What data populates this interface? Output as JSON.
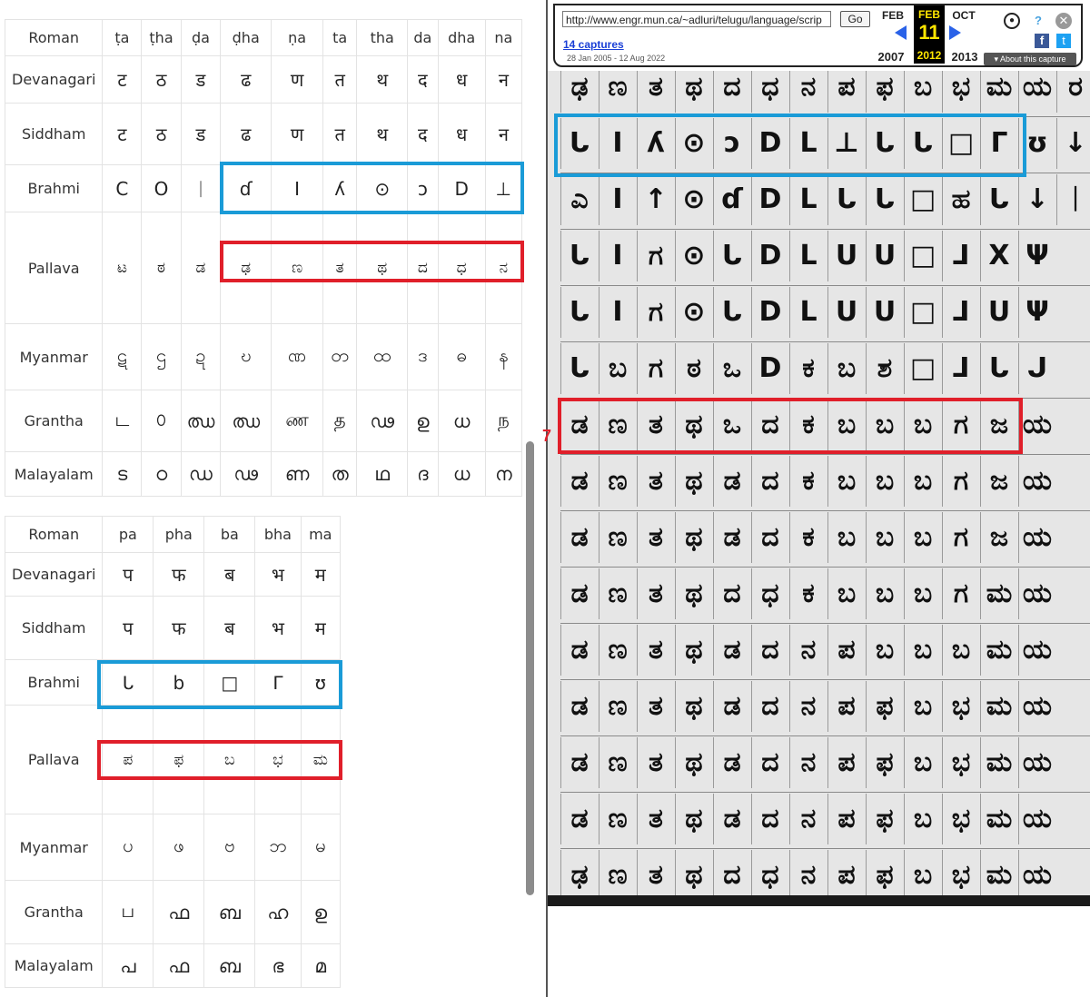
{
  "table1": {
    "header": "Roman",
    "columns": [
      "ṭa",
      "ṭha",
      "ḍa",
      "ḍha",
      "ṇa",
      "ta",
      "tha",
      "da",
      "dha",
      "na"
    ],
    "rows": [
      {
        "label": "Devanagari",
        "glyphs": [
          "ट",
          "ठ",
          "ड",
          "ढ",
          "ण",
          "त",
          "थ",
          "द",
          "ध",
          "न"
        ]
      },
      {
        "label": "Siddham",
        "glyphs": [
          "ट",
          "ठ",
          "ड",
          "ढ",
          "ण",
          "त",
          "थ",
          "द",
          "ध",
          "न"
        ]
      },
      {
        "label": "Brahmi",
        "glyphs": [
          "C",
          "O",
          "ᛁ",
          "ɗ",
          "I",
          "ʎ",
          "⊙",
          "ɔ",
          "D",
          "⊥"
        ]
      },
      {
        "label": "Pallava",
        "glyphs": [
          "ಟ",
          "ಠ",
          "ಡ",
          "ಢ",
          "ಣ",
          "ತ",
          "ಥ",
          "ದ",
          "ಧ",
          "ನ"
        ]
      },
      {
        "label": "Myanmar",
        "glyphs": [
          "ဋ",
          "ဌ",
          "ဍ",
          "ဎ",
          "ဏ",
          "တ",
          "ထ",
          "ဒ",
          "ဓ",
          "န"
        ]
      },
      {
        "label": "Grantha",
        "glyphs": [
          "ட",
          "௦",
          "ഝ",
          "ഝ",
          "ண",
          "த",
          "ഢ",
          "ഉ",
          "ധ",
          "ந"
        ]
      },
      {
        "label": "Malayalam",
        "glyphs": [
          "ട",
          "ഠ",
          "ഡ",
          "ഢ",
          "ണ",
          "ത",
          "ഥ",
          "ദ",
          "ധ",
          "ന"
        ]
      }
    ]
  },
  "table2": {
    "header": "Roman",
    "columns": [
      "pa",
      "pha",
      "ba",
      "bha",
      "ma"
    ],
    "rows": [
      {
        "label": "Devanagari",
        "glyphs": [
          "प",
          "फ",
          "ब",
          "भ",
          "म"
        ]
      },
      {
        "label": "Siddham",
        "glyphs": [
          "प",
          "फ",
          "ब",
          "भ",
          "म"
        ]
      },
      {
        "label": "Brahmi",
        "glyphs": [
          "ᒐ",
          "b",
          "□",
          "ᒥ",
          "ʊ"
        ]
      },
      {
        "label": "Pallava",
        "glyphs": [
          "ಪ",
          "ಫ",
          "ಬ",
          "ಭ",
          "ಮ"
        ]
      },
      {
        "label": "Myanmar",
        "glyphs": [
          "ပ",
          "ဖ",
          "ဗ",
          "ဘ",
          "မ"
        ]
      },
      {
        "label": "Grantha",
        "glyphs": [
          "ப",
          "ഫ",
          "ബ",
          "ഹ",
          "ഉ"
        ]
      },
      {
        "label": "Malayalam",
        "glyphs": [
          "പ",
          "ഫ",
          "ബ",
          "ഭ",
          "മ"
        ]
      }
    ]
  },
  "wayback": {
    "url": "http://www.engr.mun.ca/~adluri/telugu/language/scrip",
    "go_label": "Go",
    "captures_label": "14 captures",
    "date_range": "28 Jan 2005 - 12 Aug 2022",
    "prev_month": "FEB",
    "prev_year": "2007",
    "current_month": "FEB",
    "current_day": "11",
    "current_year": "2012",
    "next_month": "OCT",
    "next_year": "2013",
    "about_label": "▾ About this capture"
  },
  "scan": {
    "row_marker": "7",
    "rows": [
      "ಢಣತಥದಧನಪಫಬಭಮಯರ",
      "ᒐIʎ⊙ɔDL⊥ᒐᒐ□ᒥʊ↓",
      "ಎI↑⊙ɗDLᒐᒐ□ಹᒐ↓ᛁ",
      "ᒐIಗ⊙ᒐDLᑌᑌ□ᒧXΨ",
      "ᒐIಗ⊙ᒐDLᑌᑌ□ᒧUΨ",
      "ᒐಬಗಠಒDಕಬಶ□ᒧᒐᒍ",
      "ಡಣತಥಒದಕಬಬಬಗಜಯ",
      "ಡಣತಥಡದಕಬಬಬಗಜಯ",
      "ಡಣತಥಡದಕಬಬಬಗಜಯ",
      "ಡಣತಥದಧಕಬಬಬಗಮಯ",
      "ಡಣತಥಡದನಪಬಬಬಮಯ",
      "ಡಣತಥಡದನಪಫಬಭಮಯ",
      "ಡಣತಥಡದನಪಫಬಭಮಯ",
      "ಡಣತಥಡದನಪಫಬಭಮಯ",
      "ಢಣತಥದಧನಪಫಬಭಮಯ"
    ]
  }
}
